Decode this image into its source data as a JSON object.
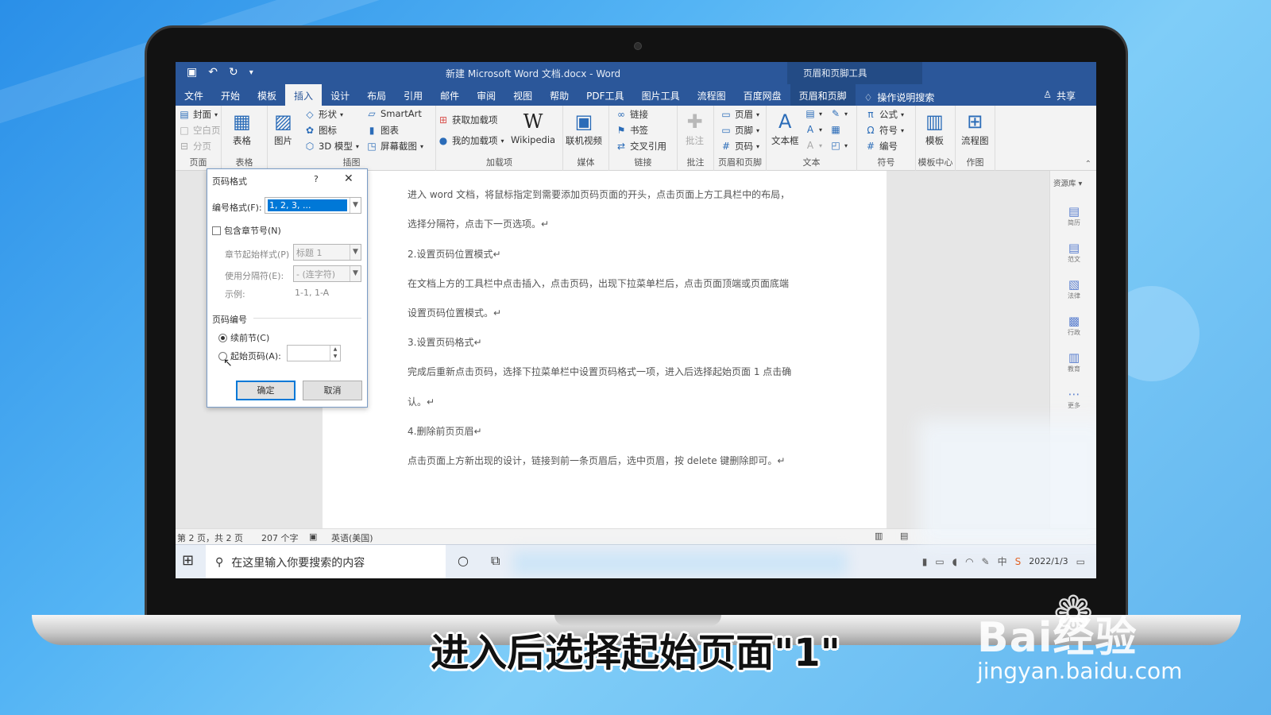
{
  "titlebar": {
    "doc_title": "新建 Microsoft Word 文档.docx  -  Word",
    "context_title": "页眉和页脚工具",
    "qat": {
      "save_icon": "save-icon",
      "undo_icon": "undo-icon",
      "redo_icon": "redo-icon"
    }
  },
  "tabs": [
    {
      "label": "文件"
    },
    {
      "label": "开始"
    },
    {
      "label": "模板"
    },
    {
      "label": "插入"
    },
    {
      "label": "设计"
    },
    {
      "label": "布局"
    },
    {
      "label": "引用"
    },
    {
      "label": "邮件"
    },
    {
      "label": "审阅"
    },
    {
      "label": "视图"
    },
    {
      "label": "帮助"
    },
    {
      "label": "PDF工具"
    },
    {
      "label": "图片工具"
    },
    {
      "label": "流程图"
    },
    {
      "label": "百度网盘"
    },
    {
      "label": "页眉和页脚"
    }
  ],
  "active_tab": "插入",
  "tell_me": "操作说明搜索",
  "share": "共享",
  "ribbon": {
    "page": {
      "label": "页面",
      "cover": "封面",
      "blank": "空白页",
      "break": "分页"
    },
    "table": {
      "label": "表格",
      "btn": "表格"
    },
    "illustrations": {
      "label": "插图",
      "picture": "图片",
      "shapes": "形状",
      "icons": "图标",
      "model3d": "3D 模型",
      "smartart": "SmartArt",
      "chart": "图表",
      "screenshot": "屏幕截图"
    },
    "addins": {
      "label": "加载项",
      "get": "获取加载项",
      "my": "我的加载项",
      "wikipedia": "Wikipedia"
    },
    "media": {
      "label": "媒体",
      "video": "联机视频"
    },
    "links": {
      "label": "链接",
      "link": "链接",
      "bookmark": "书签",
      "xref": "交叉引用"
    },
    "comments": {
      "label": "批注",
      "btn": "批注"
    },
    "header_footer": {
      "label": "页眉和页脚",
      "header": "页眉",
      "footer": "页脚",
      "pagenum": "页码"
    },
    "text": {
      "label": "文本",
      "textbox": "文本框"
    },
    "symbols": {
      "label": "符号",
      "equation": "公式",
      "symbol": "符号",
      "number": "编号"
    },
    "template_center": {
      "label": "模板中心",
      "btn": "模板"
    },
    "drawing": {
      "label": "作图",
      "btn": "流程图"
    }
  },
  "document": {
    "lines": [
      "进入 word 文档，将鼠标指定到需要添加页码页面的开头，点击页面上方工具栏中的布局，",
      "选择分隔符，点击下一页选项。↵",
      "2.设置页码位置模式↵",
      "在文档上方的工具栏中点击插入，点击页码，出现下拉菜单栏后，点击页面顶端或页面底端",
      "设置页码位置模式。↵",
      "3.设置页码格式↵",
      "完成后重新点击页码，选择下拉菜单栏中设置页码格式一项，进入后选择起始页面 1 点击确",
      "认。↵",
      "4.删除前页页眉↵",
      "点击页面上方新出现的设计，链接到前一条页眉后，选中页眉，按 delete 键删除即可。↵"
    ]
  },
  "side_panel": {
    "title": "资源库",
    "items": [
      {
        "label": "简历"
      },
      {
        "label": "范文"
      },
      {
        "label": "法律"
      },
      {
        "label": "行政"
      },
      {
        "label": "教育"
      },
      {
        "label": "更多"
      }
    ]
  },
  "dialog": {
    "title": "页码格式",
    "help": "?",
    "number_format_label": "编号格式(F):",
    "number_format_value": "1, 2, 3, ...",
    "include_chapter": "包含章节号(N)",
    "chapter_style_label": "章节起始样式(P)",
    "chapter_style_value": "标题 1",
    "separator_label": "使用分隔符(E):",
    "separator_value": "-  (连字符)",
    "example_label": "示例:",
    "example_value": "1-1, 1-A",
    "numbering_section": "页码编号",
    "continue_label": "续前节(C)",
    "start_at_label": "起始页码(A):",
    "start_at_value": "",
    "ok": "确定",
    "cancel": "取消"
  },
  "statusbar": {
    "page": "第 2 页，共 2 页",
    "words": "207 个字",
    "language": "英语(美国)"
  },
  "taskbar": {
    "search_placeholder": "在这里输入你要搜索的内容",
    "date": "2022/1/3"
  },
  "caption": "进入后选择起始页面\"1\"",
  "watermark": {
    "brand": "Bai经验",
    "url": "jingyan.baidu.com"
  },
  "colors": {
    "word_blue": "#2b579a",
    "accent": "#0078d7"
  }
}
